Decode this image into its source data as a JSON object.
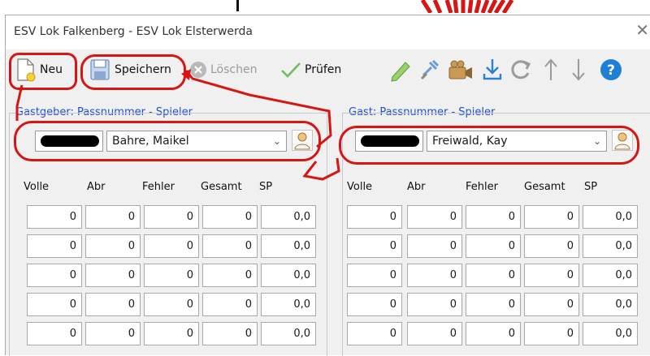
{
  "window": {
    "title": "ESV Lok Falkenberg - ESV Lok Elsterwerda"
  },
  "toolbar": {
    "new_label": "Neu",
    "save_label": "Speichern",
    "delete_label": "Löschen",
    "check_label": "Prüfen",
    "icons": [
      "pencil-icon",
      "plug-icon",
      "camera-icon",
      "download-icon",
      "refresh-icon",
      "arrow-up-icon",
      "arrow-down-icon",
      "help-icon"
    ],
    "help_glyph": "?"
  },
  "host": {
    "label": "Gastgeber: Passnummer - Spieler",
    "player": "Bahre, Maikel"
  },
  "guest": {
    "label": "Gast: Passnummer - Spieler",
    "player": "Freiwald, Kay"
  },
  "columns": [
    "Volle",
    "Abr",
    "Fehler",
    "Gesamt",
    "SP"
  ],
  "rows": [
    [
      "0",
      "0",
      "0",
      "0",
      "0,0"
    ],
    [
      "0",
      "0",
      "0",
      "0",
      "0,0"
    ],
    [
      "0",
      "0",
      "0",
      "0",
      "0,0"
    ],
    [
      "0",
      "0",
      "0",
      "0",
      "0,0"
    ],
    [
      "0",
      "0",
      "0",
      "0",
      "0,0"
    ]
  ],
  "colors": {
    "annotation": "#d61515",
    "group_label": "#1f4fd1",
    "help_blue": "#1e7fd6"
  }
}
